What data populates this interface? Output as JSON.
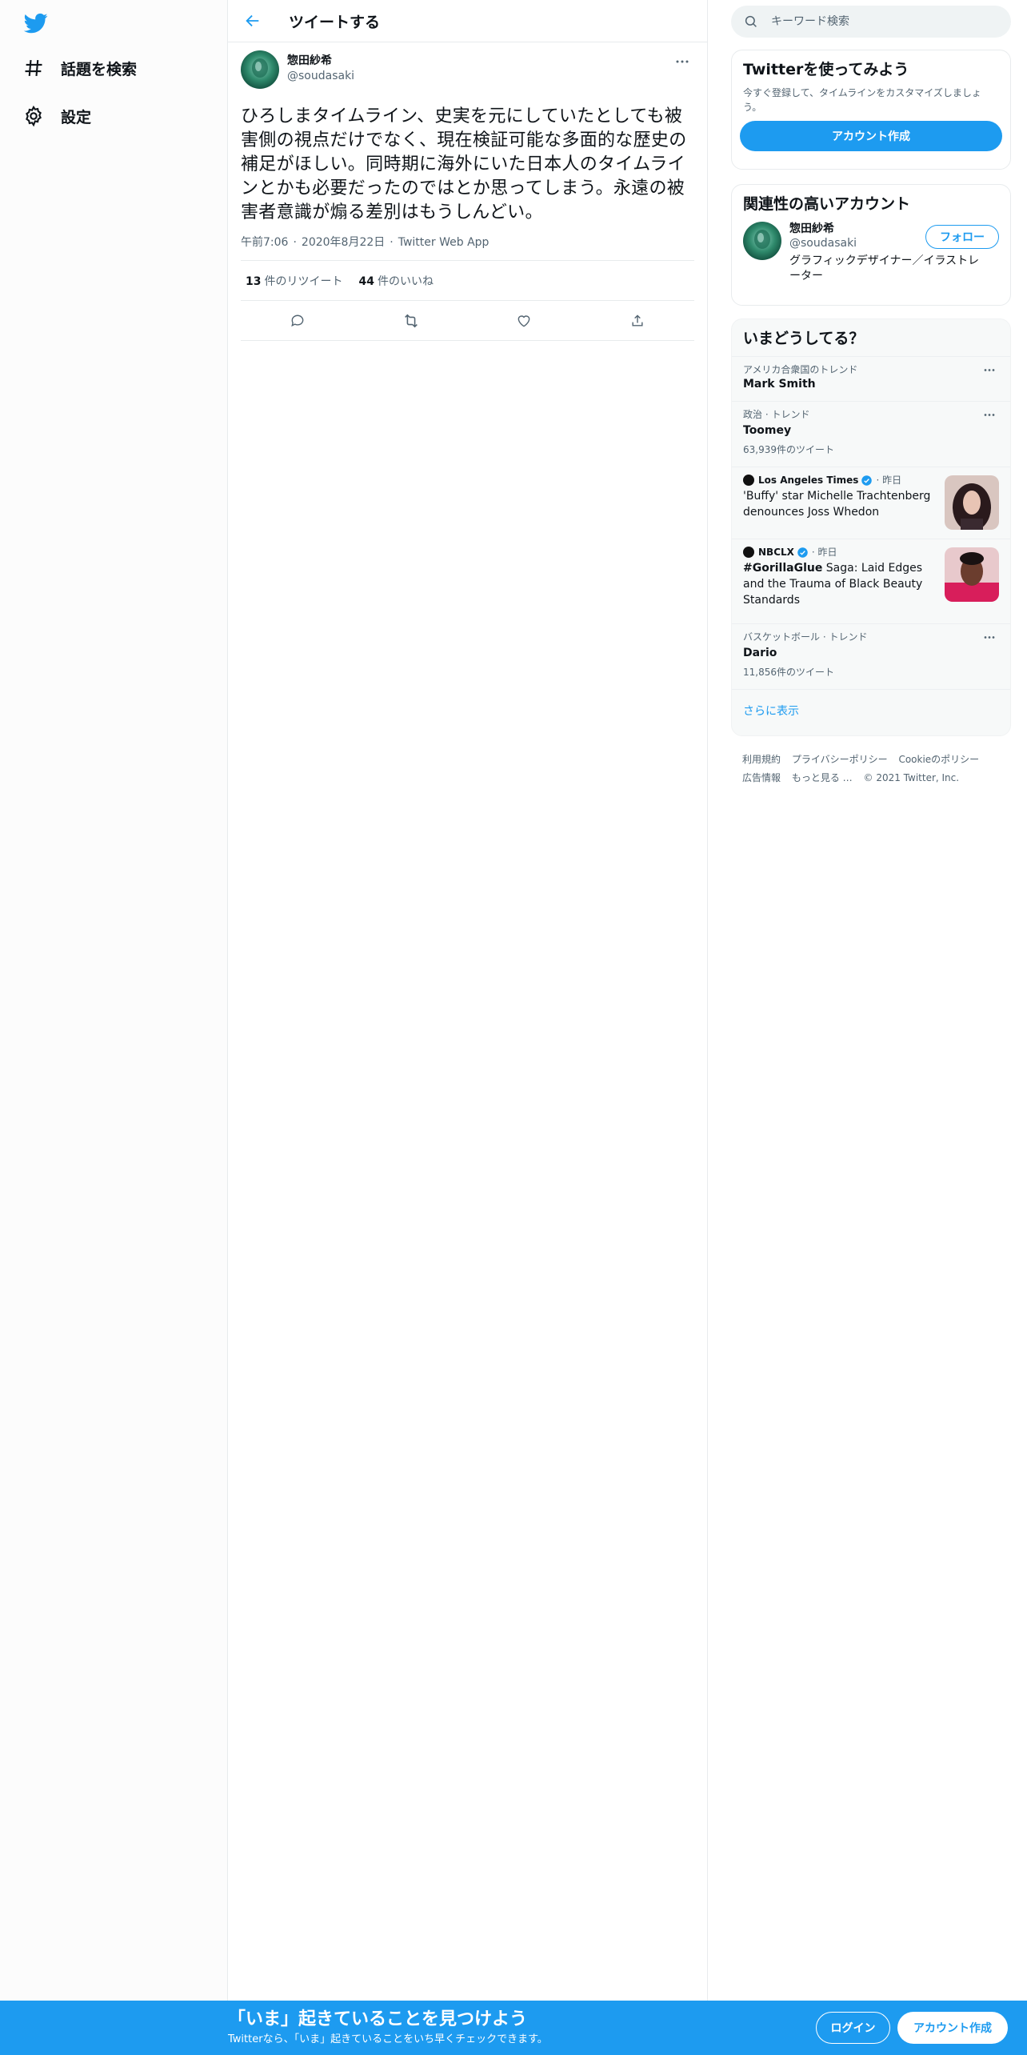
{
  "nav": {
    "logo": "twitter-bird-icon",
    "items": [
      {
        "label": "話題を検索",
        "icon": "hashtag-icon"
      },
      {
        "label": "設定",
        "icon": "gear-icon"
      }
    ]
  },
  "header": {
    "title": "ツイートする",
    "back_icon": "arrow-left-icon"
  },
  "tweet": {
    "author_name": "惣田紗希",
    "author_handle": "@soudasaki",
    "text": "ひろしまタイムライン、史実を元にしていたとしても被害側の視点だけでなく、現在検証可能な多面的な歴史の補足がほしい。同時期に海外にいた日本人のタイムラインとかも必要だったのではとか思ってしまう。永遠の被害者意識が煽る差別はもうしんどい。",
    "time": "午前7:06",
    "date": "2020年8月22日",
    "source": "Twitter Web App",
    "separator": "·",
    "retweets": {
      "count": "13",
      "label": "件のリツイート"
    },
    "likes": {
      "count": "44",
      "label": "件のいいね"
    }
  },
  "sidebar": {
    "search_placeholder": "キーワード検索",
    "signup_card": {
      "title": "Twitterを使ってみよう",
      "desc": "今すぐ登録して、タイムラインをカスタマイズしましょう。",
      "button": "アカウント作成"
    },
    "who_card": {
      "title": "関連性の高いアカウント",
      "name": "惣田紗希",
      "handle": "@soudasaki",
      "follow": "フォロー",
      "bio": "グラフィックデザイナー／イラストレーター"
    },
    "trends_card": {
      "title": "いまどうしてる？",
      "trends": [
        {
          "context": "アメリカ合衆国のトレンド",
          "title": "Mark Smith",
          "count": ""
        },
        {
          "context": "政治 · トレンド",
          "title": "Toomey",
          "count": "63,939件のツイート"
        }
      ],
      "news": [
        {
          "source": "Los Angeles Times",
          "time": "· 昨日",
          "title": "'Buffy' star Michelle Trachtenberg denounces Joss Whedon"
        },
        {
          "source": "NBCLX",
          "time": "· 昨日",
          "title_bold": "#GorillaGlue",
          "title": " Saga: Laid Edges and the Trauma of Black Beauty Standards"
        }
      ],
      "trend3": {
        "context": "バスケットボール · トレンド",
        "title": "Dario",
        "count": "11,856件のツイート"
      },
      "show_more": "さらに表示"
    },
    "footer": {
      "links": [
        "利用規約",
        "プライバシーポリシー",
        "Cookieのポリシー",
        "広告情報",
        "もっと見る …"
      ],
      "copyright": "© 2021 Twitter, Inc."
    }
  },
  "bottom_bar": {
    "title": "「いま」起きていることを見つけよう",
    "subtitle": "Twitterなら、「いま」起きていることをいち早くチェックできます。",
    "login": "ログイン",
    "signup": "アカウント作成"
  },
  "colors": {
    "accent": "#1d9bf0",
    "text": "#0f1419",
    "secondary": "#536471"
  }
}
